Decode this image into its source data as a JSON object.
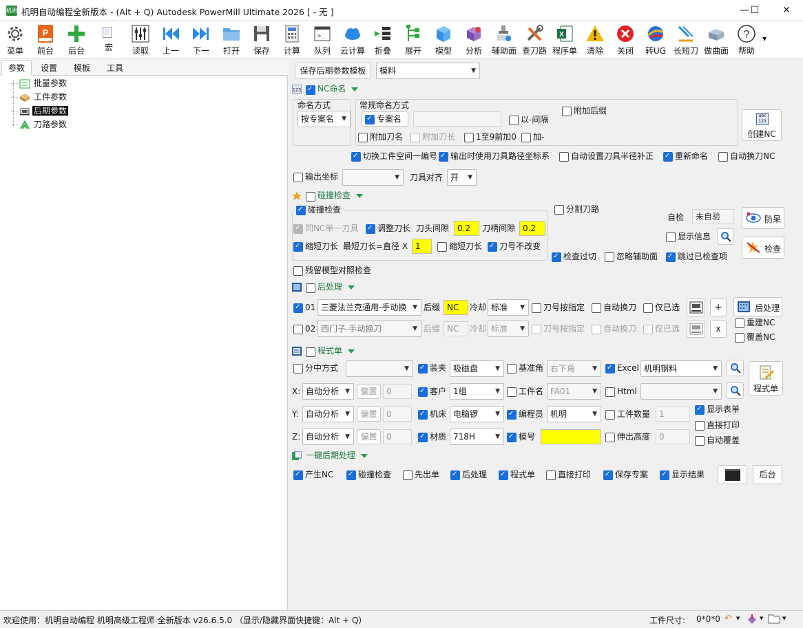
{
  "window": {
    "title": "机明自动编程全新版本 - (Alt + Q) Autodesk PowerMill Ultimate 2026   [ - 无 ]",
    "app_icon_text": "机明",
    "minimize": "—",
    "maximize": "☐",
    "close": "✕"
  },
  "toolbar": [
    {
      "label": "菜单",
      "icon": "gear-icon"
    },
    {
      "label": "前台",
      "icon": "powermill-icon"
    },
    {
      "label": "后台",
      "icon": "plus-icon"
    },
    {
      "label": "宏",
      "icon": "macro-icon"
    },
    {
      "label": "读取",
      "icon": "sliders-icon"
    },
    {
      "label": "上一",
      "icon": "previous-icon"
    },
    {
      "label": "下一",
      "icon": "next-icon"
    },
    {
      "label": "打开",
      "icon": "folder-icon"
    },
    {
      "label": "保存",
      "icon": "save-icon"
    },
    {
      "label": "计算",
      "icon": "calculator-icon"
    },
    {
      "label": "队列",
      "icon": "terminal-icon"
    },
    {
      "label": "云计算",
      "icon": "cloud-icon"
    },
    {
      "label": "折叠",
      "icon": "collapse-icon"
    },
    {
      "label": "展开",
      "icon": "expand-icon"
    },
    {
      "label": "模型",
      "icon": "cube-icon"
    },
    {
      "label": "分析",
      "icon": "analysis-icon"
    },
    {
      "label": "辅助面",
      "icon": "aux-surface-icon"
    },
    {
      "label": "查刀路",
      "icon": "tools-icon"
    },
    {
      "label": "程序单",
      "icon": "excel-icon"
    },
    {
      "label": "清除",
      "icon": "warning-icon"
    },
    {
      "label": "关闭",
      "icon": "close-circle-icon"
    },
    {
      "label": "转UG",
      "icon": "ug-icon"
    },
    {
      "label": "长短刀",
      "icon": "tool-length-icon"
    },
    {
      "label": "做曲面",
      "icon": "surface-icon"
    },
    {
      "label": "帮助",
      "icon": "help-icon"
    }
  ],
  "left": {
    "tabs": [
      "参数",
      "设置",
      "模板",
      "工具"
    ],
    "tree": [
      {
        "label": "批量参数",
        "icon": "batch-icon",
        "selected": false
      },
      {
        "label": "工件参数",
        "icon": "workpiece-icon",
        "selected": false
      },
      {
        "label": "后期参数",
        "icon": "post-params-icon",
        "selected": true
      },
      {
        "label": "刀路参数",
        "icon": "toolpath-params-icon",
        "selected": false
      }
    ]
  },
  "top": {
    "save_template": "保存后期参数模板",
    "template": "模料"
  },
  "nc_naming": {
    "section": "NC命名",
    "naming_method_group": "命名方式",
    "naming_method": "按专案名",
    "regular_group": "常规命名方式",
    "project_name": "专案名",
    "with_dash": "以-间隔",
    "add_suffix": "附加后缀",
    "add_tool_name": "附加刀名",
    "add_tool_length": "附加刀长",
    "prefix_zero": "1至9前加0",
    "add_dash": "加-",
    "create_nc": "创建NC",
    "create_nc_icon_text": "abc 123",
    "switch_workspace": "切换工件空间一编号",
    "output_toolpath_coords": "输出时使用刀具路径坐标系",
    "auto_radius_comp": "自动设置刀具半径补正",
    "rename": "重新命名",
    "auto_tool_change": "自动换刀NC",
    "output_coords": "输出坐标",
    "tool_align_label": "刀具对齐",
    "tool_align": "开"
  },
  "collision": {
    "section": "碰撞检查",
    "group": "碰撞检查",
    "same_nc_tool": "同NC单一刀具",
    "adjust_length": "调整刀长",
    "head_gap_label": "刀头间隙",
    "head_gap": "0.2",
    "holder_gap_label": "刀柄间隙",
    "holder_gap": "0.2",
    "shorten": "缩短刀长",
    "min_length_label": "最短刀长=直径 X",
    "min_length": "1",
    "shorten2": "缩短刀长",
    "keep_tool_no": "刀号不改变",
    "split_path": "分割刀路",
    "self_check_label": "自检",
    "self_check": "未自验",
    "anti_stay": "防呆",
    "show_info": "显示信息",
    "check": "检查",
    "check_overcut": "检查过切",
    "ignore_aux": "忽略辅助面",
    "skip_checked": "跳过已检查项",
    "residual_model": "残留模型对照检查"
  },
  "post": {
    "section": "后处理",
    "rows": [
      {
        "no": "01",
        "post": "三菱法兰克通用-手动换",
        "suffix_label": "后缀",
        "suffix": "NC",
        "cool_label": "冷却",
        "cool": "标准",
        "by_tool": "刀号按指定",
        "auto_change": "自动换刀",
        "only_selected": "仅已选",
        "action": "+"
      },
      {
        "no": "02",
        "post": "西门子-手动换刀",
        "suffix_label": "后缀",
        "suffix": "NC",
        "cool_label": "冷却",
        "cool": "标准",
        "by_tool": "刀号按指定",
        "auto_change": "自动换刀",
        "only_selected": "仅已选",
        "action": "x"
      }
    ],
    "post_button": "后处理",
    "rebuild": "重建NC",
    "overwrite": "覆盖NC"
  },
  "program_sheet": {
    "section": "程式单",
    "split_mode": "分中方式",
    "clamp": "装夹",
    "clamp_val": "吸磁盘",
    "base_angle": "基准角",
    "base_angle_val": "右下角",
    "excel": "Excel",
    "excel_val": "机明钢料",
    "x_label": "X:",
    "x_mode": "自动分析",
    "offset": "偏置",
    "x_off": "0",
    "customer": "客户",
    "customer_val": "1组",
    "part_name": "工件名",
    "part_name_val": "FA01",
    "html": "Html",
    "y_label": "Y:",
    "y_mode": "自动分析",
    "y_off": "0",
    "machine": "机床",
    "machine_val": "电脑锣",
    "programmer": "编程员",
    "programmer_val": "机明",
    "part_qty": "工件数量",
    "part_qty_val": "1",
    "show_sheet": "显示表单",
    "z_label": "Z:",
    "z_mode": "自动分析",
    "z_off": "0",
    "material": "材质",
    "material_val": "718H",
    "mold_no": "模号",
    "mold_no_val": "",
    "overhang": "伸出高度",
    "overhang_val": "0",
    "direct_print": "直接打印",
    "auto_overwrite": "自动覆盖",
    "program_button": "程式单"
  },
  "one_click": {
    "section": "一键后期处理",
    "gen_nc": "产生NC",
    "collision": "碰撞检查",
    "sheet_first": "先出单",
    "post": "后处理",
    "sheet": "程式单",
    "print": "直接打印",
    "save_project": "保存专案",
    "show_result": "显示结果",
    "background": "后台"
  },
  "status": {
    "welcome": "欢迎使用：机明自动编程 机明高级工程师 全新版本 v26.6.5.0 （显示/隐藏界面快捷键：Alt + Q）",
    "size_label": "工件尺寸:",
    "size_value": "0*0*0"
  },
  "colors": {
    "accent_green": "#1d7a3d",
    "check_blue": "#1a6ed8",
    "highlight_yellow": "#ffff00"
  }
}
